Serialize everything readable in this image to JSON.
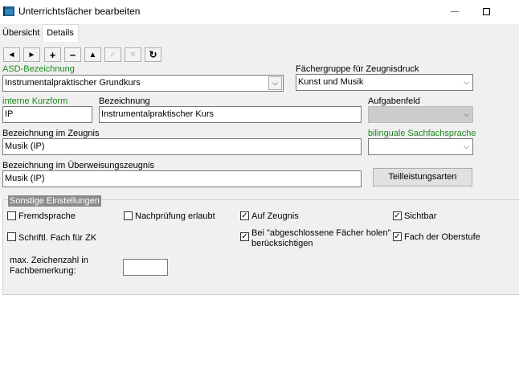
{
  "window": {
    "title": "Unterrichtsfächer bearbeiten",
    "minimize_glyph": "—",
    "maximize_glyph": "☐"
  },
  "tabs": [
    {
      "label": "Übersicht",
      "active": false
    },
    {
      "label": "Details",
      "active": true
    }
  ],
  "toolbar": {
    "buttons": [
      {
        "icon": "arrow-left-icon",
        "glyph": "◄",
        "enabled": true
      },
      {
        "icon": "arrow-right-icon",
        "glyph": "►",
        "enabled": true
      },
      {
        "icon": "plus-icon",
        "glyph": "+",
        "enabled": true
      },
      {
        "icon": "minus-icon",
        "glyph": "−",
        "enabled": true
      },
      {
        "icon": "arrow-up-icon",
        "glyph": "▲",
        "enabled": true
      },
      {
        "icon": "check-icon",
        "glyph": "✓",
        "enabled": false
      },
      {
        "icon": "cancel-icon",
        "glyph": "✕",
        "enabled": false
      },
      {
        "icon": "refresh-icon",
        "glyph": "↻",
        "enabled": true
      }
    ]
  },
  "form": {
    "asd_label": "ASD-Bezeichnung",
    "asd_value": "Instrumentalpraktischer Grundkurs",
    "faechergruppe_label": "Fächergruppe für Zeugnisdruck",
    "faechergruppe_value": "Kunst und Musik",
    "kurzform_label": "interne Kurzform",
    "kurzform_value": "IP",
    "bezeichnung_label": "Bezeichnung",
    "bezeichnung_value": "Instrumentalpraktischer Kurs",
    "aufgabenfeld_label": "Aufgabenfeld",
    "aufgabenfeld_value": "",
    "zeugnis_label": "Bezeichnung im Zeugnis",
    "zeugnis_value": "Musik (IP)",
    "bilingual_label": "bilinguale Sachfachsprache",
    "bilingual_value": "",
    "ueberweisung_label": "Bezeichnung im Überweisungszeugnis",
    "ueberweisung_value": "Musik (IP)",
    "teilleistung_button": "Teilleistungsarten"
  },
  "settings": {
    "legend": "Sonstige Einstellungen",
    "checkboxes": [
      {
        "label": "Fremdsprache",
        "checked": false
      },
      {
        "label": "Nachprüfung erlaubt",
        "checked": false
      },
      {
        "label": "Auf Zeugnis",
        "checked": true
      },
      {
        "label": "Sichtbar",
        "checked": true
      },
      {
        "label": "Schriftl. Fach für ZK",
        "checked": false
      },
      {
        "label_line1": "Bei \"abgeschlossene Fächer holen\"",
        "label_line2": "berücksichtigen",
        "checked": true
      },
      {
        "label": "Fach der Oberstufe",
        "checked": true
      }
    ],
    "max_chars_label_line1": "max. Zeichenzahl in",
    "max_chars_label_line2": "Fachbemerkung:",
    "max_chars_value": ""
  },
  "colors": {
    "green_label": "#1e8a1e",
    "panel": "#f0f0f0"
  }
}
